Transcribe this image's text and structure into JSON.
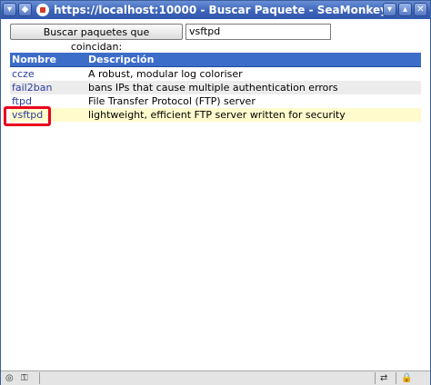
{
  "window": {
    "title": "https://localhost:10000 - Buscar Paquete - SeaMonkey",
    "menu_glyph": "▾",
    "sticky_glyph": "◆",
    "minimize_glyph": "▾",
    "maximize_glyph": "▴",
    "close_glyph": "✕"
  },
  "search": {
    "button_label": "Buscar paquetes que coincidan:",
    "input_value": "vsftpd"
  },
  "table": {
    "headers": {
      "name": "Nombre",
      "description": "Descripción"
    },
    "rows": [
      {
        "name": "ccze",
        "description": "A robust, modular log coloriser"
      },
      {
        "name": "fail2ban",
        "description": "bans IPs that cause multiple authentication errors"
      },
      {
        "name": "ftpd",
        "description": "File Transfer Protocol (FTP) server"
      },
      {
        "name": "vsftpd",
        "description": "lightweight, efficient FTP server written for security"
      }
    ]
  },
  "colors": {
    "title_bar": "#3c64b8",
    "table_header": "#3c6dc8",
    "selected_row": "#fffbcc",
    "highlight": "#e8001c"
  },
  "statusbar": {
    "icons": [
      "globe-icon",
      "key-icon",
      "connection-icon",
      "lock-icon"
    ]
  }
}
